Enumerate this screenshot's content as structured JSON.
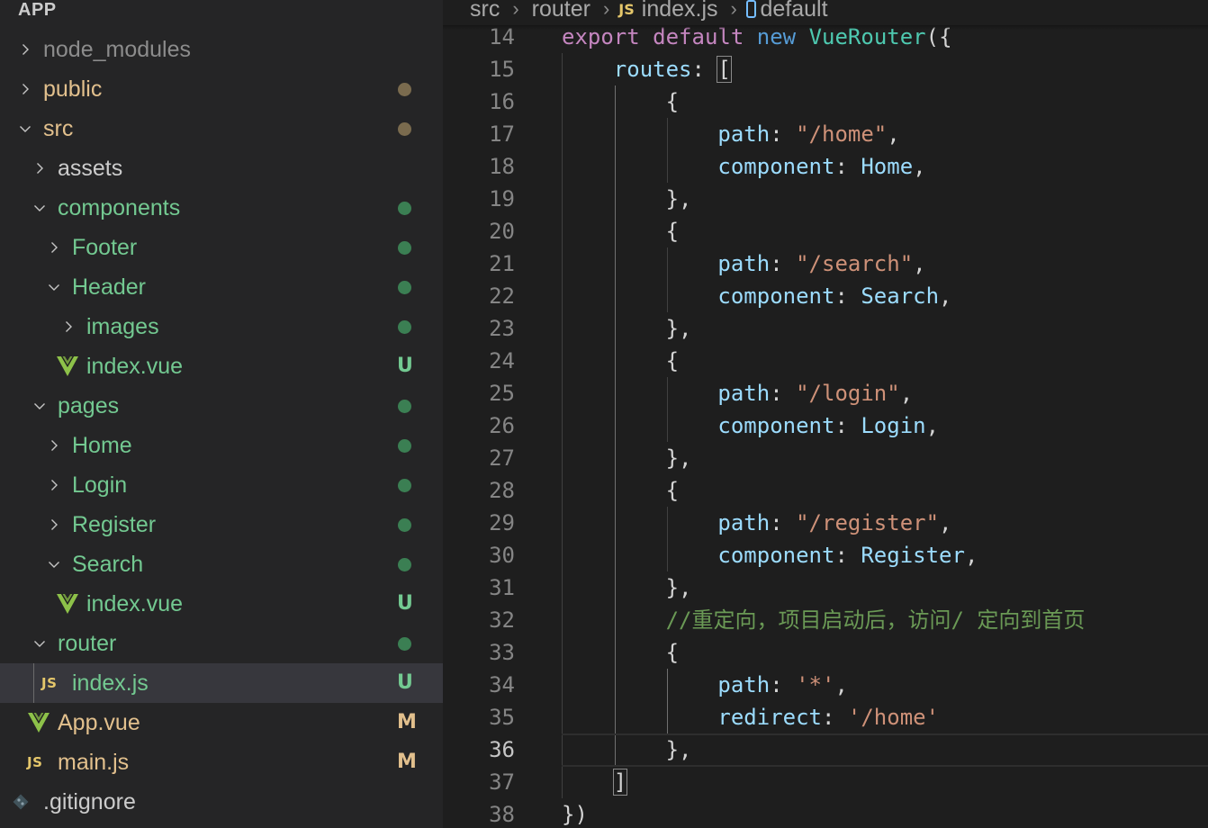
{
  "colors": {
    "untracked_green": "#73c991",
    "modified_yellow": "#e2c08d",
    "ignored_gray": "#8c8c8c",
    "default_text": "#cccccc",
    "vue_green": "#8dc149",
    "dot_green": "#3b7f53",
    "dot_brown": "#7a6b4e"
  },
  "explorer": {
    "header": "APP",
    "items": [
      {
        "label": "node_modules",
        "type": "folder",
        "expanded": false,
        "depth": 0,
        "color": "#8c8c8c",
        "badge": ""
      },
      {
        "label": "public",
        "type": "folder",
        "expanded": false,
        "depth": 0,
        "color": "#e2c08d",
        "badge": "dot"
      },
      {
        "label": "src",
        "type": "folder",
        "expanded": true,
        "depth": 0,
        "color": "#e2c08d",
        "badge": "dot"
      },
      {
        "label": "assets",
        "type": "folder",
        "expanded": false,
        "depth": 1,
        "color": "#cccccc",
        "badge": ""
      },
      {
        "label": "components",
        "type": "folder",
        "expanded": true,
        "depth": 1,
        "color": "#73c991",
        "badge": "dot"
      },
      {
        "label": "Footer",
        "type": "folder",
        "expanded": false,
        "depth": 2,
        "color": "#73c991",
        "badge": "dot"
      },
      {
        "label": "Header",
        "type": "folder",
        "expanded": true,
        "depth": 2,
        "color": "#73c991",
        "badge": "dot"
      },
      {
        "label": "images",
        "type": "folder",
        "expanded": false,
        "depth": 3,
        "color": "#73c991",
        "badge": "dot"
      },
      {
        "label": "index.vue",
        "type": "vue",
        "depth": 3,
        "color": "#73c991",
        "badge": "U"
      },
      {
        "label": "pages",
        "type": "folder",
        "expanded": true,
        "depth": 1,
        "color": "#73c991",
        "badge": "dot"
      },
      {
        "label": "Home",
        "type": "folder",
        "expanded": false,
        "depth": 2,
        "color": "#73c991",
        "badge": "dot"
      },
      {
        "label": "Login",
        "type": "folder",
        "expanded": false,
        "depth": 2,
        "color": "#73c991",
        "badge": "dot"
      },
      {
        "label": "Register",
        "type": "folder",
        "expanded": false,
        "depth": 2,
        "color": "#73c991",
        "badge": "dot"
      },
      {
        "label": "Search",
        "type": "folder",
        "expanded": true,
        "depth": 2,
        "color": "#73c991",
        "badge": "dot"
      },
      {
        "label": "index.vue",
        "type": "vue",
        "depth": 3,
        "color": "#73c991",
        "badge": "U"
      },
      {
        "label": "router",
        "type": "folder",
        "expanded": true,
        "depth": 1,
        "color": "#73c991",
        "badge": "dot"
      },
      {
        "label": "index.js",
        "type": "js",
        "depth": 2,
        "color": "#73c991",
        "badge": "U",
        "selected": true
      },
      {
        "label": "App.vue",
        "type": "vue",
        "depth": 1,
        "color": "#e2c08d",
        "badge": "M"
      },
      {
        "label": "main.js",
        "type": "js",
        "depth": 1,
        "color": "#e2c08d",
        "badge": "M"
      },
      {
        "label": ".gitignore",
        "type": "git",
        "depth": 0,
        "color": "#cccccc",
        "badge": ""
      }
    ]
  },
  "breadcrumb": {
    "parts": [
      "src",
      "router",
      "index.js",
      "default"
    ],
    "file_icon": "JS"
  },
  "editor": {
    "active_line": 36,
    "lines": [
      {
        "n": "14",
        "tokens": [
          [
            "export",
            "kw"
          ],
          [
            " ",
            "pun"
          ],
          [
            "default",
            "kw"
          ],
          [
            " ",
            "pun"
          ],
          [
            "new",
            "blue"
          ],
          [
            " ",
            "pun"
          ],
          [
            "VueRouter",
            "cls"
          ],
          [
            "({",
            "pun"
          ]
        ]
      },
      {
        "n": "15",
        "tokens": [
          [
            "    ",
            "pun"
          ],
          [
            "routes",
            "prop"
          ],
          [
            ": ",
            "pun"
          ],
          [
            "[",
            "pun"
          ]
        ]
      },
      {
        "n": "16",
        "tokens": [
          [
            "        {",
            "pun"
          ]
        ]
      },
      {
        "n": "17",
        "tokens": [
          [
            "            ",
            "pun"
          ],
          [
            "path",
            "prop"
          ],
          [
            ": ",
            "pun"
          ],
          [
            "\"/home\"",
            "str"
          ],
          [
            ",",
            "pun"
          ]
        ]
      },
      {
        "n": "18",
        "tokens": [
          [
            "            ",
            "pun"
          ],
          [
            "component",
            "prop"
          ],
          [
            ": ",
            "pun"
          ],
          [
            "Home",
            "prop"
          ],
          [
            ",",
            "pun"
          ]
        ]
      },
      {
        "n": "19",
        "tokens": [
          [
            "        },",
            "pun"
          ]
        ]
      },
      {
        "n": "20",
        "tokens": [
          [
            "        {",
            "pun"
          ]
        ]
      },
      {
        "n": "21",
        "tokens": [
          [
            "            ",
            "pun"
          ],
          [
            "path",
            "prop"
          ],
          [
            ": ",
            "pun"
          ],
          [
            "\"/search\"",
            "str"
          ],
          [
            ",",
            "pun"
          ]
        ]
      },
      {
        "n": "22",
        "tokens": [
          [
            "            ",
            "pun"
          ],
          [
            "component",
            "prop"
          ],
          [
            ": ",
            "pun"
          ],
          [
            "Search",
            "prop"
          ],
          [
            ",",
            "pun"
          ]
        ]
      },
      {
        "n": "23",
        "tokens": [
          [
            "        },",
            "pun"
          ]
        ]
      },
      {
        "n": "24",
        "tokens": [
          [
            "        {",
            "pun"
          ]
        ]
      },
      {
        "n": "25",
        "tokens": [
          [
            "            ",
            "pun"
          ],
          [
            "path",
            "prop"
          ],
          [
            ": ",
            "pun"
          ],
          [
            "\"/login\"",
            "str"
          ],
          [
            ",",
            "pun"
          ]
        ]
      },
      {
        "n": "26",
        "tokens": [
          [
            "            ",
            "pun"
          ],
          [
            "component",
            "prop"
          ],
          [
            ": ",
            "pun"
          ],
          [
            "Login",
            "prop"
          ],
          [
            ",",
            "pun"
          ]
        ]
      },
      {
        "n": "27",
        "tokens": [
          [
            "        },",
            "pun"
          ]
        ]
      },
      {
        "n": "28",
        "tokens": [
          [
            "        {",
            "pun"
          ]
        ]
      },
      {
        "n": "29",
        "tokens": [
          [
            "            ",
            "pun"
          ],
          [
            "path",
            "prop"
          ],
          [
            ": ",
            "pun"
          ],
          [
            "\"/register\"",
            "str"
          ],
          [
            ",",
            "pun"
          ]
        ]
      },
      {
        "n": "30",
        "tokens": [
          [
            "            ",
            "pun"
          ],
          [
            "component",
            "prop"
          ],
          [
            ": ",
            "pun"
          ],
          [
            "Register",
            "prop"
          ],
          [
            ",",
            "pun"
          ]
        ]
      },
      {
        "n": "31",
        "tokens": [
          [
            "        },",
            "pun"
          ]
        ]
      },
      {
        "n": "32",
        "tokens": [
          [
            "        ",
            "pun"
          ],
          [
            "//重定向，项目启动后，访问/ 定向到首页",
            "cmt"
          ]
        ]
      },
      {
        "n": "33",
        "tokens": [
          [
            "        {",
            "pun"
          ]
        ]
      },
      {
        "n": "34",
        "tokens": [
          [
            "            ",
            "pun"
          ],
          [
            "path",
            "prop"
          ],
          [
            ": ",
            "pun"
          ],
          [
            "'*'",
            "str"
          ],
          [
            ",",
            "pun"
          ]
        ]
      },
      {
        "n": "35",
        "tokens": [
          [
            "            ",
            "pun"
          ],
          [
            "redirect",
            "prop"
          ],
          [
            ": ",
            "pun"
          ],
          [
            "'/home'",
            "str"
          ]
        ]
      },
      {
        "n": "36",
        "tokens": [
          [
            "        },",
            "pun"
          ]
        ]
      },
      {
        "n": "37",
        "tokens": [
          [
            "    ",
            "pun"
          ],
          [
            "]",
            "pun"
          ]
        ]
      },
      {
        "n": "38",
        "tokens": [
          [
            "})",
            "pun"
          ]
        ]
      }
    ]
  }
}
